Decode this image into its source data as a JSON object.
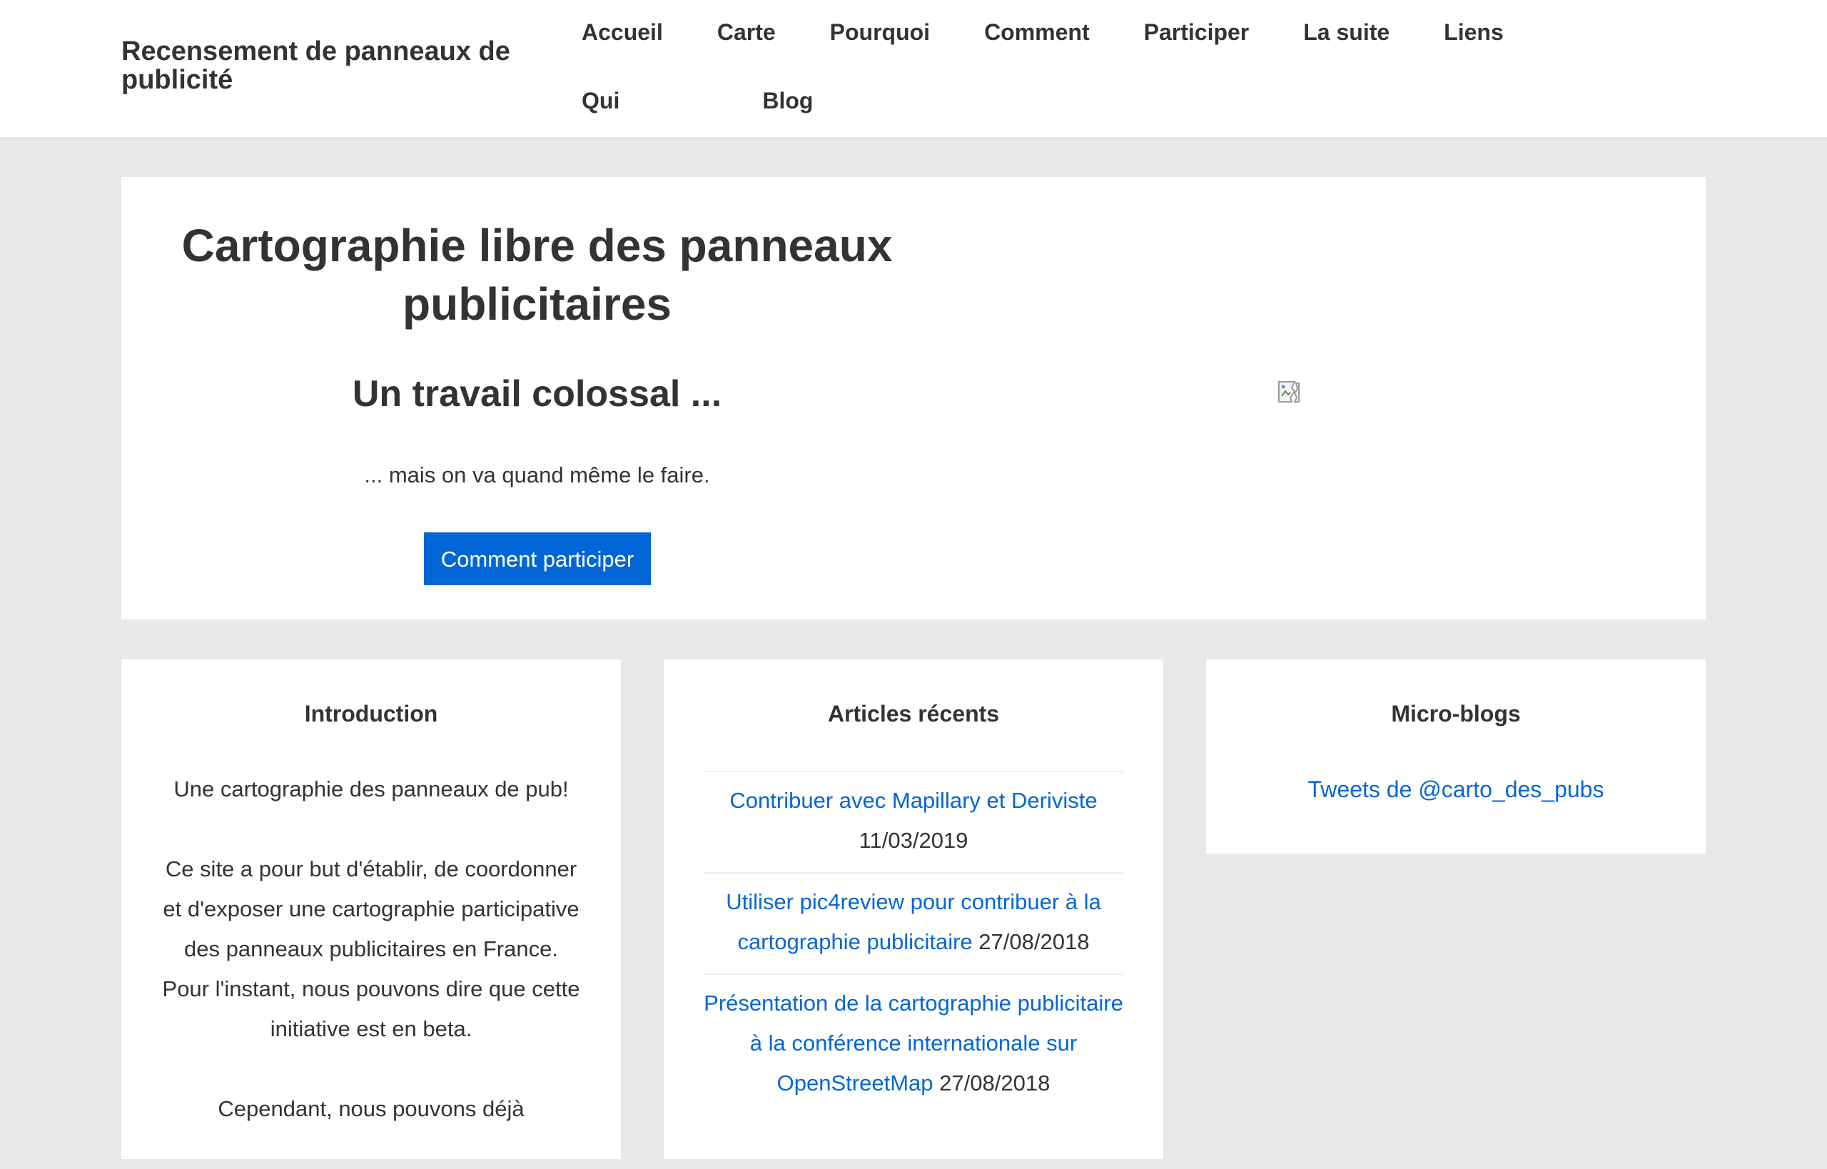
{
  "header": {
    "site_title": "Recensement de panneaux de publicité",
    "nav": [
      "Accueil",
      "Carte",
      "Pourquoi",
      "Comment",
      "Participer",
      "La suite",
      "Liens",
      "Qui",
      "Blog"
    ]
  },
  "hero": {
    "title": "Cartographie libre des panneaux publicitaires",
    "subtitle": "Un travail colossal ...",
    "text": "... mais on va quand même le faire.",
    "button_label": "Comment participer",
    "image_icon": "broken-image-icon"
  },
  "intro": {
    "title": "Introduction",
    "p1": "Une cartographie des panneaux de pub!",
    "p2": "Ce site a pour but d'établir, de coordonner et d'exposer une cartographie participative des panneaux publicitaires en France. Pour l'instant, nous pouvons dire que cette initiative est en beta.",
    "p3": "Cependant, nous pouvons déjà"
  },
  "articles": {
    "title": "Articles récents",
    "items": [
      {
        "title": "Contribuer avec Mapillary et Deriviste",
        "date": "11/03/2019"
      },
      {
        "title": "Utiliser pic4review pour contribuer à la cartographie publicitaire",
        "date": "27/08/2018"
      },
      {
        "title": "Présentation de la cartographie publicitaire à la conférence internationale sur OpenStreetMap",
        "date": "27/08/2018"
      }
    ]
  },
  "micro": {
    "title": "Micro-blogs",
    "link": "Tweets de @carto_des_pubs"
  },
  "colors": {
    "accent": "#0366d6",
    "background": "#e8e8e8",
    "text": "#333333"
  }
}
